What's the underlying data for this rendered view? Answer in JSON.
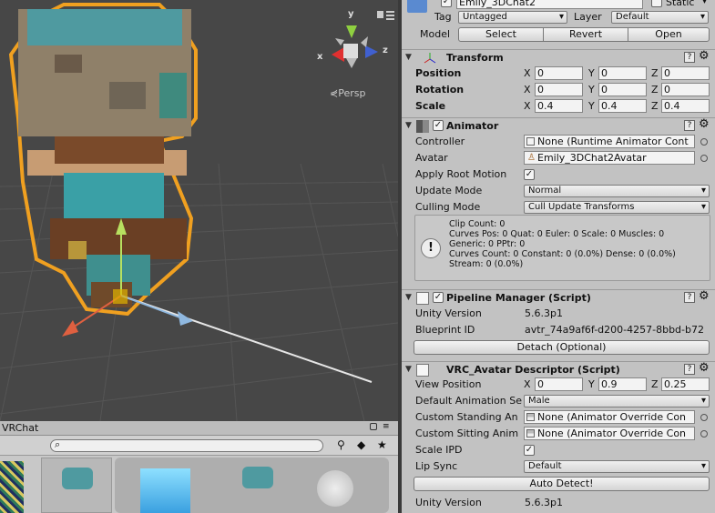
{
  "scene": {
    "projection_label": "Persp",
    "axis_x": "x",
    "axis_y": "y",
    "axis_z": "z"
  },
  "project": {
    "title": "VRChat",
    "search_placeholder": ""
  },
  "inspector": {
    "object_name": "Emily_3DChat2",
    "static_label": "Static",
    "tag_label": "Tag",
    "tag_value": "Untagged",
    "layer_label": "Layer",
    "layer_value": "Default",
    "model_label": "Model",
    "select_label": "Select",
    "revert_label": "Revert",
    "open_label": "Open",
    "transform": {
      "title": "Transform",
      "position_label": "Position",
      "rotation_label": "Rotation",
      "scale_label": "Scale",
      "x": "X",
      "y": "Y",
      "z": "Z",
      "position": [
        "0",
        "0",
        "0"
      ],
      "rotation": [
        "0",
        "0",
        "0"
      ],
      "scale": [
        "0.4",
        "0.4",
        "0.4"
      ]
    },
    "animator": {
      "title": "Animator",
      "controller_label": "Controller",
      "controller_value": "None (Runtime Animator Cont",
      "avatar_label": "Avatar",
      "avatar_value": "Emily_3DChat2Avatar",
      "apply_root_motion_label": "Apply Root Motion",
      "update_mode_label": "Update Mode",
      "update_mode_value": "Normal",
      "culling_mode_label": "Culling Mode",
      "culling_mode_value": "Cull Update Transforms",
      "info": "Clip Count: 0\nCurves Pos: 0 Quat: 0 Euler: 0 Scale: 0 Muscles: 0\nGeneric: 0 PPtr: 0\nCurves Count: 0 Constant: 0 (0.0%) Dense: 0 (0.0%)\nStream: 0 (0.0%)"
    },
    "pipeline": {
      "title": "Pipeline Manager (Script)",
      "unity_version_label": "Unity Version",
      "unity_version_value": "5.6.3p1",
      "blueprint_label": "Blueprint ID",
      "blueprint_value": "avtr_74a9af6f-d200-4257-8bbd-b72",
      "detach_label": "Detach (Optional)"
    },
    "descriptor": {
      "title": "VRC_Avatar Descriptor (Script)",
      "view_position_label": "View Position",
      "view_position": [
        "0",
        "0.9",
        "0.25"
      ],
      "default_anim_label": "Default Animation Se",
      "default_anim_value": "Male",
      "standing_label": "Custom Standing An",
      "standing_value": "None (Animator Override Con",
      "sitting_label": "Custom Sitting Anim",
      "sitting_value": "None (Animator Override Con",
      "scale_ipd_label": "Scale IPD",
      "lip_sync_label": "Lip Sync",
      "lip_sync_value": "Default",
      "auto_detect_label": "Auto Detect!",
      "unity_version_label": "Unity Version",
      "unity_version_value": "5.6.3p1"
    }
  }
}
